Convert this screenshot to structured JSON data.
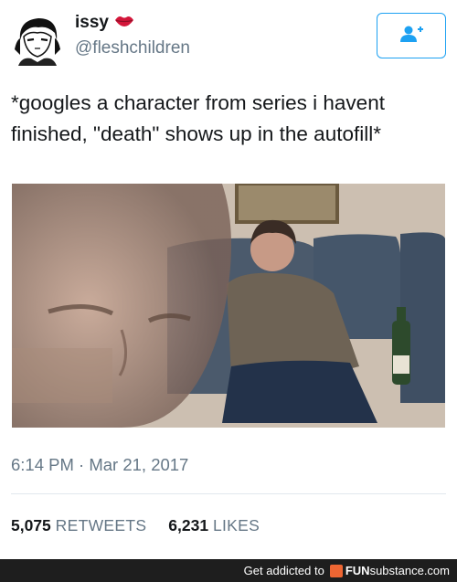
{
  "tweet": {
    "display_name": "issy",
    "handle": "@fleshchildren",
    "text": "*googles a character from series i havent finished, \"death\" shows up in the autofill*",
    "timestamp": "6:14 PM · Mar 21, 2017",
    "retweets_count": "5,075",
    "retweets_label": "RETWEETS",
    "likes_count": "6,231",
    "likes_label": "LIKES"
  },
  "icons": {
    "name_emoji": "kiss-lips-icon",
    "follow": "add-user-icon"
  },
  "colors": {
    "accent": "#1da1f2",
    "secondary_text": "#657786",
    "lips": "#d3163a"
  },
  "footer": {
    "prefix": "Get addicted to",
    "brand_fun": "FUN",
    "brand_sub": "substance.com"
  }
}
